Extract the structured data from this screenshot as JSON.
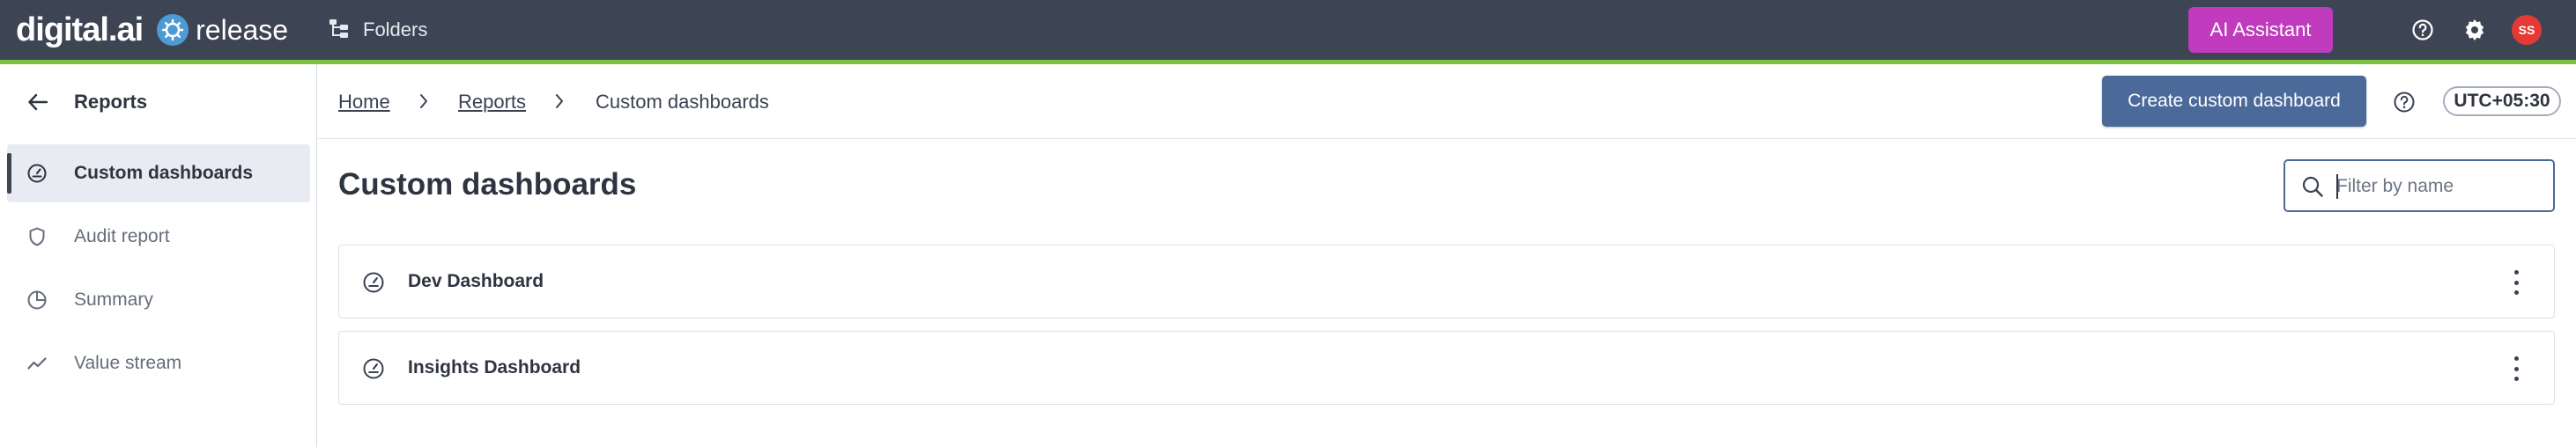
{
  "topbar": {
    "brand_digital": "digital.ai",
    "brand_product": "release",
    "folders_label": "Folders",
    "ai_button_label": "AI Assistant",
    "help_icon": "help-circle-icon",
    "settings_icon": "gear-icon",
    "avatar_initials": "SS",
    "accent_color": "#7cc242",
    "bar_color": "#3d4555",
    "ai_button_color": "#c03bbd"
  },
  "sidebar": {
    "title": "Reports",
    "items": [
      {
        "label": "Custom dashboards",
        "icon": "dashboard-gauge-icon",
        "active": true
      },
      {
        "label": "Audit report",
        "icon": "shield-icon",
        "active": false
      },
      {
        "label": "Summary",
        "icon": "pie-chart-icon",
        "active": false
      },
      {
        "label": "Value stream",
        "icon": "trend-line-icon",
        "active": false
      }
    ]
  },
  "breadcrumb": {
    "items": [
      "Home",
      "Reports",
      "Custom dashboards"
    ]
  },
  "header": {
    "create_button_label": "Create custom dashboard",
    "timezone": "UTC+05:30",
    "create_button_color": "#4c6a99"
  },
  "main": {
    "title": "Custom dashboards",
    "search_placeholder": "Filter by name",
    "dashboards": [
      {
        "name": "Dev Dashboard"
      },
      {
        "name": "Insights Dashboard"
      }
    ]
  }
}
